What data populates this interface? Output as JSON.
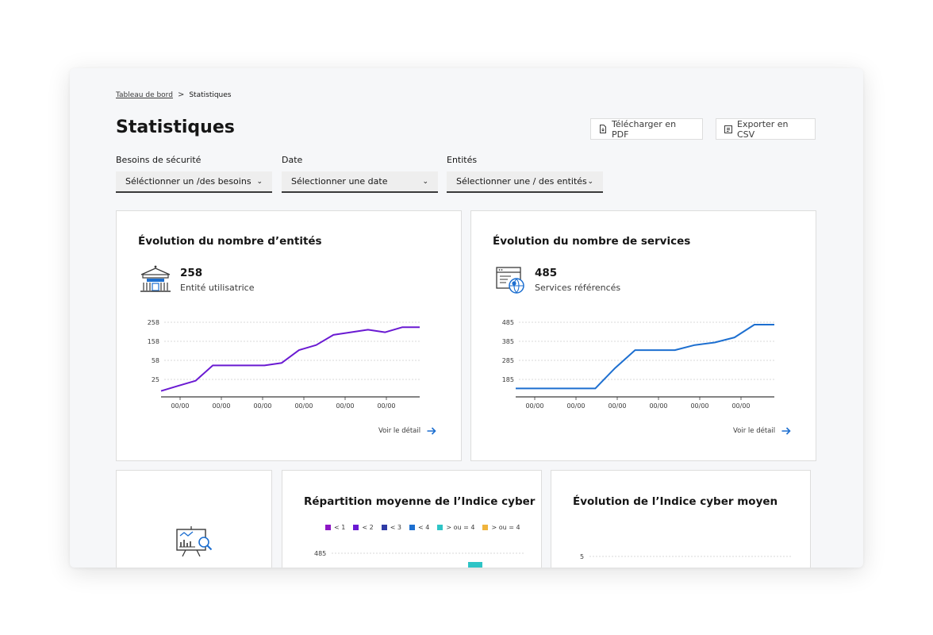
{
  "breadcrumb": {
    "home": "Tableau de bord",
    "separator": ">",
    "current": "Statistiques"
  },
  "page_title": "Statistiques",
  "actions": {
    "pdf_label": "Télécharger en PDF",
    "csv_label": "Exporter en CSV"
  },
  "filters": [
    {
      "label": "Besoins de sécurité",
      "value": "Séléctionner un /des besoins"
    },
    {
      "label": "Date",
      "value": "Sélectionner une date"
    },
    {
      "label": "Entités",
      "value": "Sélectionner une / des entités"
    }
  ],
  "cards": {
    "entities": {
      "title": "Évolution du nombre d’entités",
      "kpi_value": "258",
      "kpi_label": "Entité utilisatrice",
      "icon": "building-icon",
      "detail": "Voir le détail",
      "color": "#6a1ad2"
    },
    "services": {
      "title": "Évolution du nombre de services",
      "kpi_value": "485",
      "kpi_label": "Services référencés",
      "icon": "web-service-icon",
      "detail": "Voir le détail",
      "color": "#1d6fd0"
    },
    "placeholder": {
      "icon": "presentation-search-icon"
    },
    "cyber_distribution": {
      "title": "Répartition moyenne de l’Indice cyber",
      "legend": [
        {
          "label": "< 1",
          "color": "#8d16c4"
        },
        {
          "label": "< 2",
          "color": "#6a1ad2"
        },
        {
          "label": "< 3",
          "color": "#2f3ba6"
        },
        {
          "label": "< 4",
          "color": "#1d6fd0"
        },
        {
          "label": "> ou = 4",
          "color": "#2ec4c6"
        },
        {
          "label": "> ou = 4",
          "color": "#f0b43c"
        }
      ],
      "first_tick": "485"
    },
    "cyber_evolution": {
      "title": "Évolution de l’Indice cyber moyen",
      "first_tick": "5"
    }
  },
  "chart_data": [
    {
      "type": "line",
      "title": "Évolution du nombre d’entités",
      "yticks": [
        "258",
        "158",
        "58",
        "25"
      ],
      "xticks": [
        "00/00",
        "00/00",
        "00/00",
        "00/00",
        "00/00",
        "00/00"
      ],
      "series": [
        {
          "values": [
            2,
            4,
            6,
            12,
            12,
            12,
            12,
            13,
            18,
            20,
            24,
            25,
            26,
            25,
            27,
            27
          ]
        }
      ],
      "color": "#6a1ad2"
    },
    {
      "type": "line",
      "title": "Évolution du nombre de services",
      "yticks": [
        "485",
        "385",
        "285",
        "185"
      ],
      "xticks": [
        "00/00",
        "00/00",
        "00/00",
        "00/00",
        "00/00",
        "00/00"
      ],
      "series": [
        {
          "values": [
            3,
            3,
            3,
            3,
            3,
            11,
            18,
            18,
            18,
            20,
            21,
            23,
            28,
            28
          ]
        }
      ],
      "color": "#1d6fd0"
    }
  ]
}
